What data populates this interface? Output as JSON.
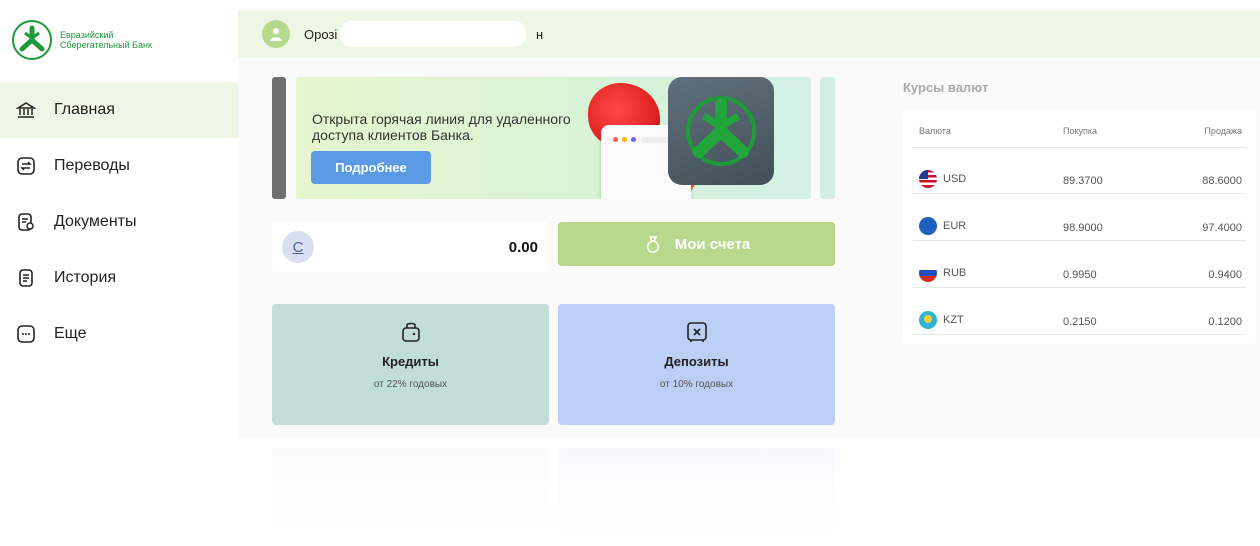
{
  "bank": {
    "name_line1": "Евразийский",
    "name_line2": "Сберегательный Банк"
  },
  "sidebar": {
    "items": [
      {
        "label": "Главная",
        "icon": "bank-icon",
        "active": true
      },
      {
        "label": "Переводы",
        "icon": "transfer-icon",
        "active": false
      },
      {
        "label": "Документы",
        "icon": "document-icon",
        "active": false
      },
      {
        "label": "История",
        "icon": "history-icon",
        "active": false
      },
      {
        "label": "Еще",
        "icon": "more-icon",
        "active": false
      }
    ]
  },
  "header": {
    "user_name_start": "Орозі",
    "user_name_end": "н"
  },
  "banner": {
    "text": "Открыта горячая линия для удаленного доступа клиентов Банка.",
    "button_label": "Подробнее"
  },
  "balance": {
    "currency_symbol": "С",
    "value": "0.00"
  },
  "accounts_button": {
    "label": "Мои счета"
  },
  "products": [
    {
      "title": "Кредиты",
      "subtitle": "от 22% годовых",
      "icon": "wallet-icon"
    },
    {
      "title": "Депозиты",
      "subtitle": "от 10% годовых",
      "icon": "safe-icon"
    }
  ],
  "rates": {
    "title": "Курсы валют",
    "headers": {
      "currency": "Валюта",
      "buy": "Покупка",
      "sell": "Продажа"
    },
    "rows": [
      {
        "code": "USD",
        "buy": "89.3700",
        "sell": "88.6000",
        "flag": "us-flag-icon"
      },
      {
        "code": "EUR",
        "buy": "98.9000",
        "sell": "97.4000",
        "flag": "eu-flag-icon"
      },
      {
        "code": "RUB",
        "buy": "0.9950",
        "sell": "0.9400",
        "flag": "ru-flag-icon"
      },
      {
        "code": "KZT",
        "buy": "0.2150",
        "sell": "0.1200",
        "flag": "kz-flag-icon"
      }
    ]
  },
  "colors": {
    "brand_green": "#1f9a3a",
    "accent_light_green": "#b6d98b",
    "button_blue": "#5b9be6"
  }
}
